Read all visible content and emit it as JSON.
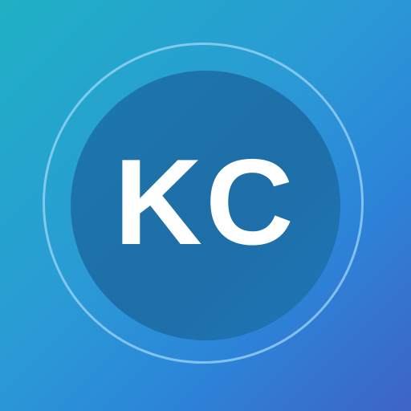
{
  "logo": {
    "monogram": "KC"
  },
  "colors": {
    "background_start": "#1fb0c4",
    "background_end": "#3f63c8",
    "disc": "#1e6ea8",
    "ring": "#a0d7f5",
    "text": "#ffffff"
  }
}
